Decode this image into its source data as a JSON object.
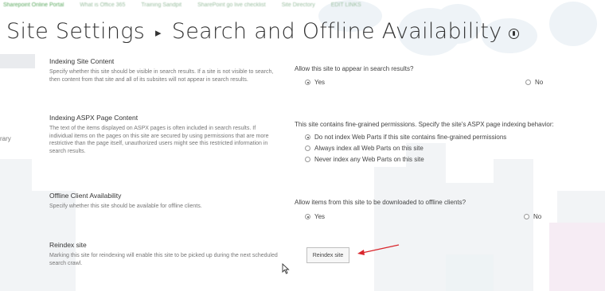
{
  "topnav": [
    "Sharepoint Online Portal",
    "What is Office 365",
    "Training Sandpit",
    "SharePoint go live checklist",
    "Site Directory",
    "EDIT LINKS"
  ],
  "page": {
    "breadcrumb_root": "Site Settings",
    "separator": "▸",
    "title": "Search and Offline Availability"
  },
  "left_nav": {
    "fragment": "rary"
  },
  "sections": {
    "indexing": {
      "title": "Indexing Site Content",
      "desc": "Specify whether this site should be visible in search results. If a site is not visible to search, then content from that site and all of its subsites will not appear in search results.",
      "question": "Allow this site to appear in search results?",
      "yes": "Yes",
      "no": "No",
      "selected": "yes"
    },
    "aspx": {
      "title": "Indexing ASPX Page Content",
      "desc": "The text of the items displayed on ASPX pages is often included in search results. If individual items on the pages on this site are secured by using permissions that are more restrictive than the page itself, unauthorized users might see this restricted information in search results.",
      "question": "This site contains fine-grained permissions. Specify the site's ASPX page indexing behavior:",
      "options": [
        "Do not index Web Parts if this site contains fine-grained permissions",
        "Always index all Web Parts on this site",
        "Never index any Web Parts on this site"
      ],
      "selected_index": 0
    },
    "offline": {
      "title": "Offline Client Availability",
      "desc": "Specify whether this site should be available for offline clients.",
      "question": "Allow items from this site to be downloaded to offline clients?",
      "yes": "Yes",
      "no": "No",
      "selected": "yes"
    },
    "reindex": {
      "title": "Reindex site",
      "desc": "Marking this site for reindexing will enable this site to be picked up during the next scheduled search crawl.",
      "button_label": "Reindex site"
    }
  },
  "colors": {
    "annotation_arrow": "#d9262c",
    "nav_link": "#5aa85e",
    "background_art": "#e8eef3"
  }
}
